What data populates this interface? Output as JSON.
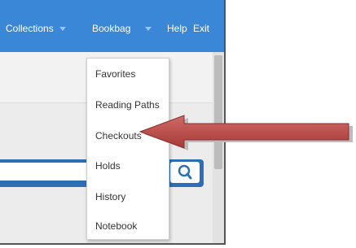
{
  "nav": {
    "collections": "Collections",
    "bookbag": "Bookbag",
    "help": "Help",
    "exit": "Exit"
  },
  "dropdown": {
    "items": [
      "Favorites",
      "Reading Paths",
      "Checkouts",
      "Holds",
      "History",
      "Notebook"
    ],
    "highlighted": "Checkouts"
  },
  "icons": {
    "search": "search-icon",
    "arrow": "pointer-arrow-icon"
  },
  "colors": {
    "topbar": "#3a87d8",
    "searchbar": "#2c6fb6",
    "arrow_red": "#c0504d"
  }
}
